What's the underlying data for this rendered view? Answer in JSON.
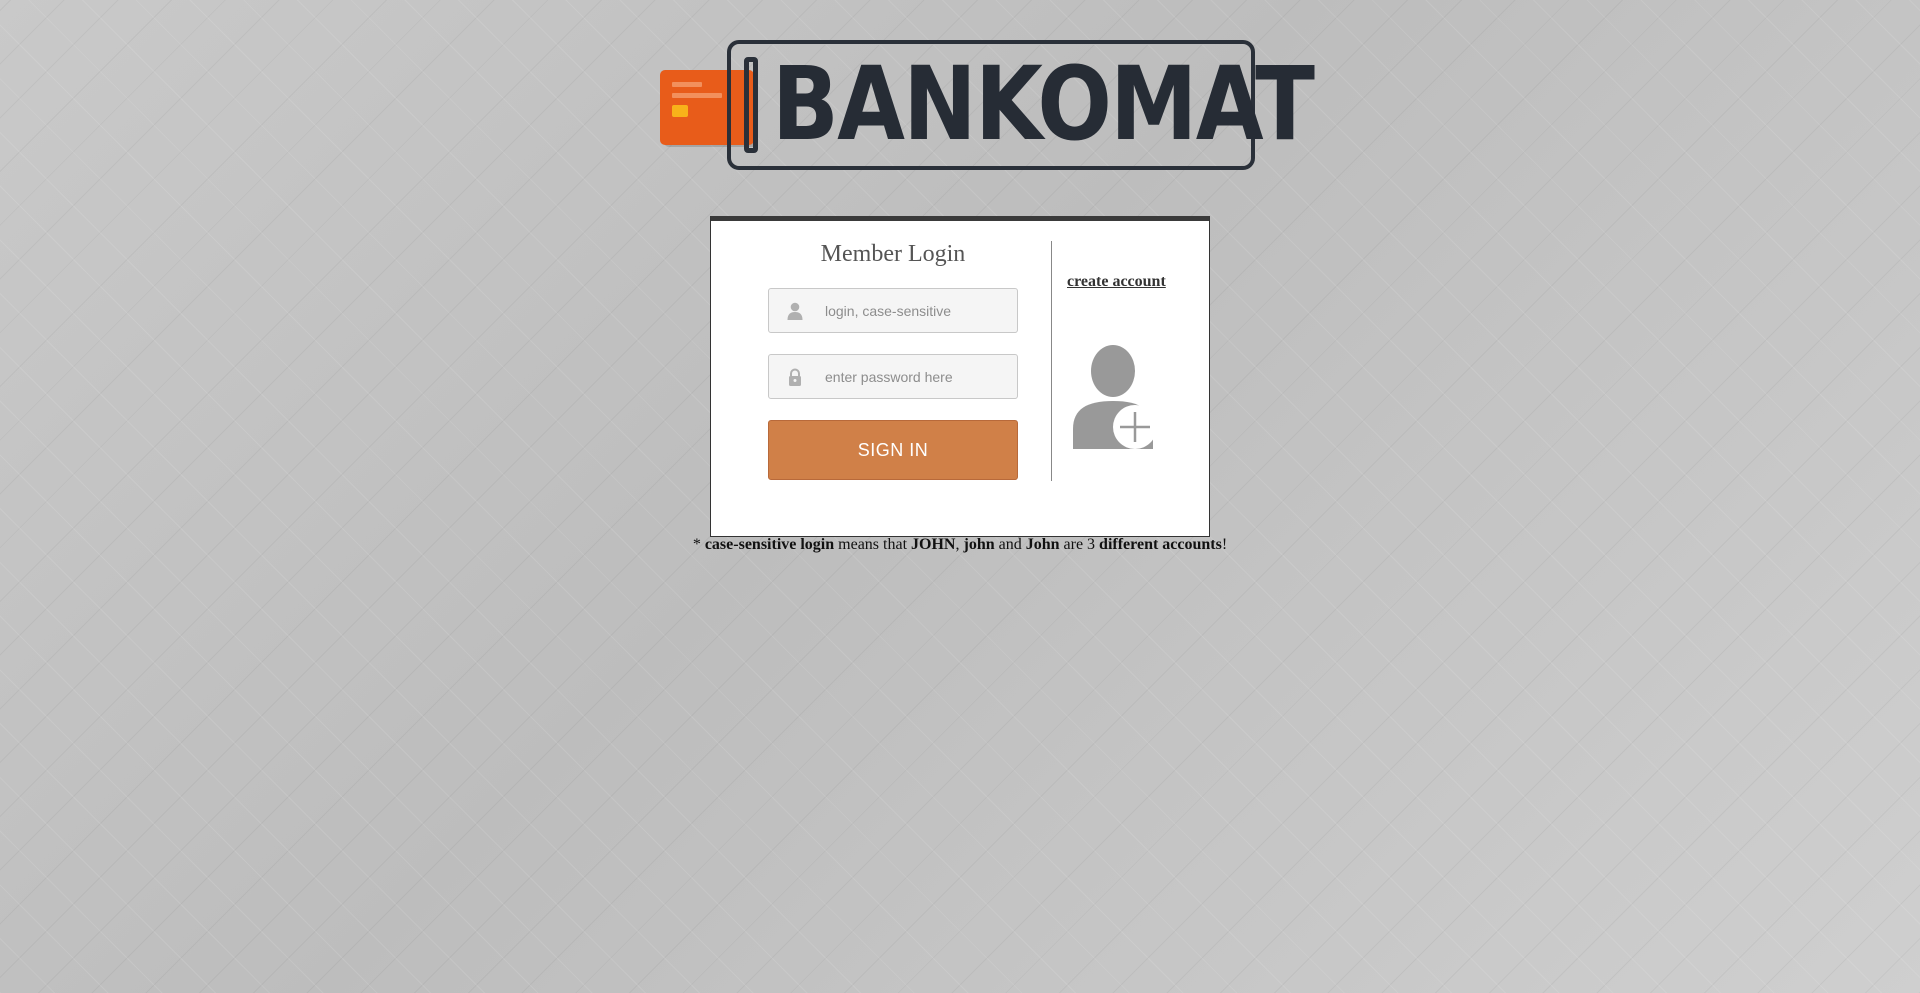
{
  "logo": {
    "text": "BANKOMAT",
    "colors": {
      "card": "#e85c1a",
      "text": "#262c35"
    }
  },
  "login": {
    "title": "Member Login",
    "login_field": {
      "placeholder": "login, case-sensitive",
      "value": ""
    },
    "password_field": {
      "placeholder": "enter password here",
      "value": ""
    },
    "signin_label": "SIGN IN",
    "signin_color": "#d08048",
    "create_account_label": "create account",
    "icons": {
      "login": "user-icon",
      "password": "lock-icon",
      "create": "add-user-icon"
    }
  },
  "note": {
    "prefix": "* ",
    "term": "case-sensitive login",
    "middle1": " means that ",
    "ex1": "JOHN",
    "sep1": ", ",
    "ex2": "john",
    "sep2": " and ",
    "ex3": "John",
    "middle2": " are 3 ",
    "emphasis": "different accounts",
    "suffix": "!"
  }
}
